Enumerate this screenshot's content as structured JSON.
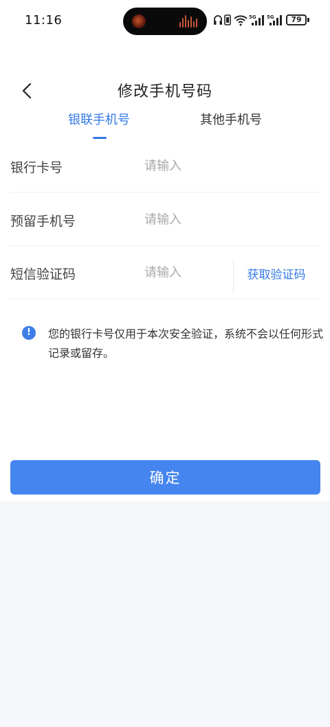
{
  "status_bar": {
    "time": "11:16",
    "battery": "79",
    "icons": [
      "headphones-icon",
      "vibrate-icon",
      "wifi-icon",
      "signal-5g-icon",
      "signal-5g-icon",
      "battery-icon"
    ]
  },
  "header": {
    "title": "修改手机号码",
    "back_icon": "chevron-left-icon"
  },
  "tabs": [
    {
      "label": "银联手机号",
      "active": true
    },
    {
      "label": "其他手机号",
      "active": false
    }
  ],
  "form": {
    "rows": [
      {
        "label": "银行卡号",
        "placeholder": "请输入",
        "value": ""
      },
      {
        "label": "预留手机号",
        "placeholder": "请输入",
        "value": ""
      },
      {
        "label": "短信验证码",
        "placeholder": "请输入",
        "value": ""
      }
    ],
    "get_code_label": "获取验证码"
  },
  "notice": {
    "icon": "info-icon",
    "text": "您的银行卡号仅用于本次安全验证，系统不会以任何形式记录或留存。"
  },
  "confirm_label": "确定",
  "colors": {
    "accent": "#3478e5",
    "button": "#4585ef",
    "background": "#f5f7fb"
  }
}
